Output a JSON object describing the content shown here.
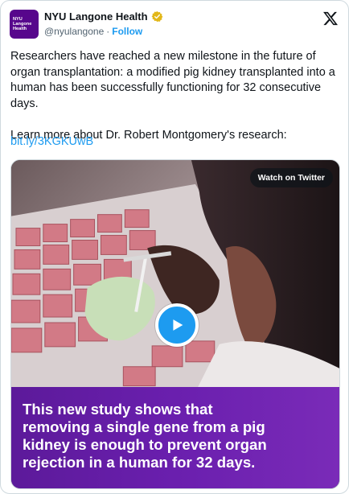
{
  "account": {
    "logo_line1": "NYU Langone",
    "logo_line2": "Health",
    "name": "NYU Langone Health",
    "handle": "@nyulangone",
    "separator": "·",
    "follow_label": "Follow"
  },
  "tweet": {
    "text": "Researchers have reached a new milestone in the future of organ transplantation: a modified pig kidney transplanted into a human has been successfully functioning for 32 consecutive days.\n\nLearn more about Dr. Robert Montgomery's research:",
    "link": "bit.ly/3KGKUwB"
  },
  "media": {
    "watch_label": "Watch on Twitter",
    "caption": "This new study shows that\nremoving a single gene from a pig\nkidney is enough to prevent organ\nrejection in a human for 32 days."
  },
  "colors": {
    "brand": "#57068c",
    "link": "#1d9bf0",
    "caption_band": "#6a1fae"
  },
  "icons": {
    "verified": "verified-badge-icon",
    "platform": "x-logo-icon",
    "play": "play-icon"
  }
}
